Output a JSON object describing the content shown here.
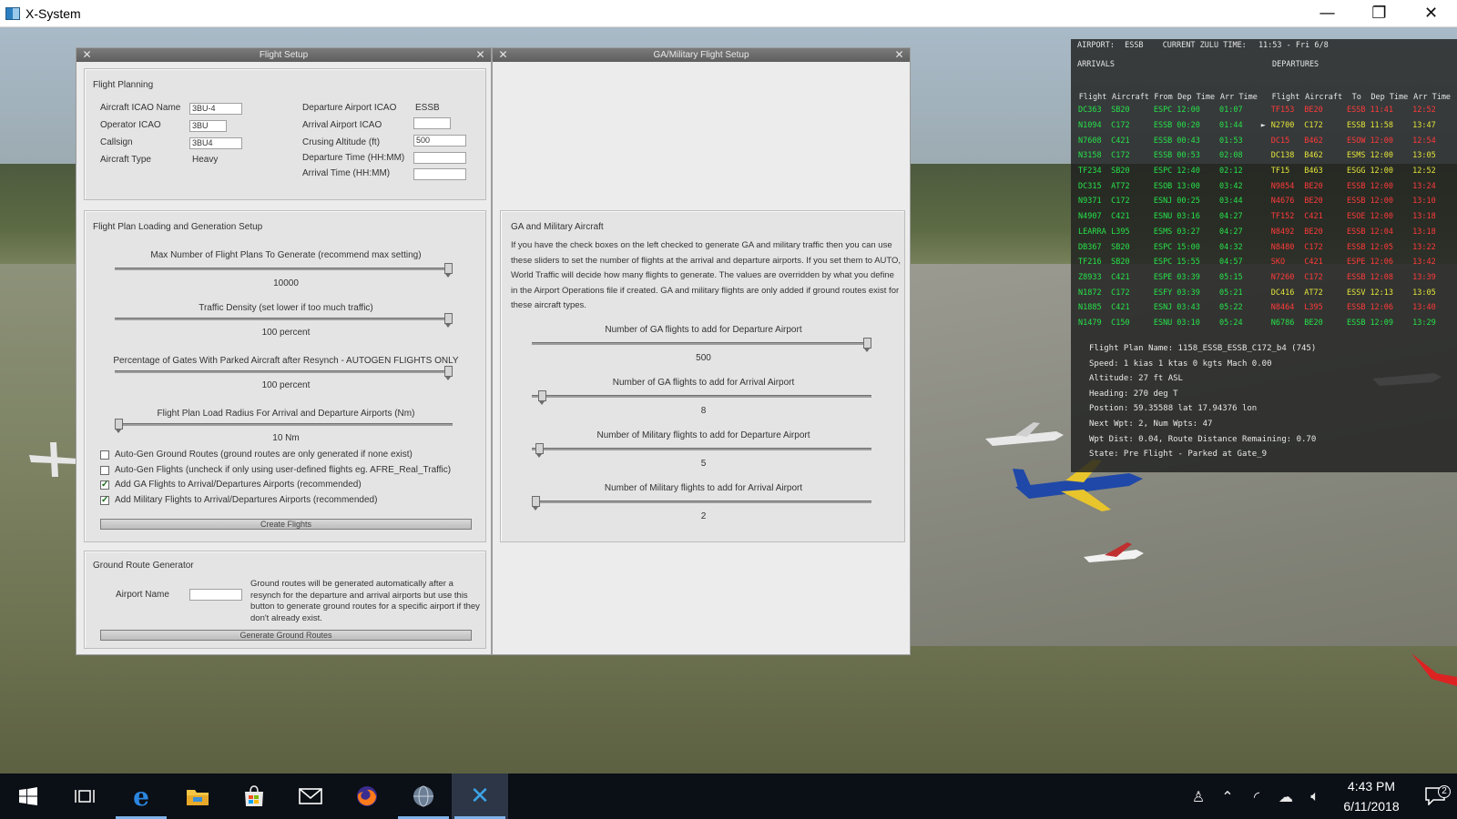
{
  "window": {
    "title": "X-System",
    "minimize": "—",
    "restore": "❐",
    "close": "✕"
  },
  "flight_setup": {
    "title": "Flight Setup",
    "planning": {
      "heading": "Flight Planning",
      "aircraft_icao_label": "Aircraft ICAO Name",
      "aircraft_icao_value": "3BU-4",
      "operator_icao_label": "Operator ICAO",
      "operator_icao_value": "3BU",
      "callsign_label": "Callsign",
      "callsign_value": "3BU4",
      "aircraft_type_label": "Aircraft Type",
      "aircraft_type_value": "Heavy",
      "departure_icao_label": "Departure Airport ICAO",
      "departure_icao_value": "ESSB",
      "arrival_icao_label": "Arrival Airport ICAO",
      "arrival_icao_value": "",
      "cruise_alt_label": "Crusing Altitude (ft)",
      "cruise_alt_value": "500",
      "departure_time_label": "Departure Time (HH:MM)",
      "departure_time_value": "",
      "arrival_time_label": "Arrival Time (HH:MM)",
      "arrival_time_value": ""
    },
    "loading": {
      "heading": "Flight Plan Loading and Generation Setup",
      "max_plans_label": "Max Number of Flight Plans To Generate (recommend max setting)",
      "max_plans_value": "10000",
      "max_plans_level": 1.0,
      "density_label": "Traffic Density (set lower if too much traffic)",
      "density_value": "100 percent",
      "density_level": 1.0,
      "gates_label": "Percentage of Gates With Parked Aircraft after Resynch - AUTOGEN FLIGHTS ONLY",
      "gates_value": "100 percent",
      "gates_level": 1.0,
      "radius_label": "Flight Plan Load Radius For Arrival and Departure Airports (Nm)",
      "radius_value": "10 Nm",
      "radius_level": 0.0,
      "checkboxes": [
        {
          "label": "Auto-Gen Ground Routes (ground routes are only generated if none exist)",
          "checked": false
        },
        {
          "label": "Auto-Gen Flights (uncheck if only using user-defined flights eg. AFRE_Real_Traffic)",
          "checked": false
        },
        {
          "label": "Add GA Flights to Arrival/Departures Airports (recommended)",
          "checked": true
        },
        {
          "label": "Add Military Flights to Arrival/Departures Airports (recommended)",
          "checked": true
        }
      ],
      "create_button": "Create Flights"
    },
    "ground": {
      "heading": "Ground Route Generator",
      "airport_label": "Airport Name",
      "airport_value": "",
      "description": "Ground routes will be generated automatically after a resynch for the departure and arrival airports but use this button to generate ground routes for a specific airport if they don't already exist.",
      "generate_button": "Generate Ground Routes"
    }
  },
  "ga_setup": {
    "title": "GA/Military Flight Setup",
    "heading": "GA and Military Aircraft",
    "description": "If you have the check boxes on the left checked to generate GA and military traffic then you can use these sliders to set the number of flights at the arrival and departure airports.  If you set them to AUTO, World Traffic will decide how many flights to generate. The values are overridden by what you define in the Airport Operations file if created. GA and military flights are only added if ground routes exist for these aircraft types.",
    "sliders": [
      {
        "label": "Number of GA flights to add for Departure Airport",
        "value": "500",
        "level": 1.0
      },
      {
        "label": "Number of GA flights to add for Arrival Airport",
        "value": "8",
        "level": 0.02
      },
      {
        "label": "Number of Military flights to add for Departure Airport",
        "value": "5",
        "level": 0.01
      },
      {
        "label": "Number of Military flights to add for Arrival Airport",
        "value": "2",
        "level": 0.0
      }
    ]
  },
  "atc": {
    "airport_label": "AIRPORT:",
    "airport": "ESSB",
    "zulu_label": "CURRENT ZULU TIME:",
    "zulu": "11:53 - Fri 6/8",
    "arrivals_title": "ARRIVALS",
    "departures_title": "DEPARTURES",
    "columns": [
      "Flight",
      "Aircraft",
      "From",
      "Dep Time",
      "Arr Time",
      "Flight",
      "Aircraft",
      "To",
      "Dep Time",
      "Arr Time"
    ],
    "rows": [
      {
        "arr": [
          "DC363",
          "SB20",
          "ESPC",
          "12:00",
          "01:07"
        ],
        "arr_color": "green",
        "dep": [
          "TF153",
          "BE20",
          "ESSB",
          "11:41",
          "12:52"
        ],
        "dep_color": "red",
        "marker": ""
      },
      {
        "arr": [
          "N1094",
          "C172",
          "ESSB",
          "00:20",
          "01:44"
        ],
        "arr_color": "green",
        "dep": [
          "N2700",
          "C172",
          "ESSB",
          "11:58",
          "13:47"
        ],
        "dep_color": "yellow",
        "marker": "►"
      },
      {
        "arr": [
          "N7608",
          "C421",
          "ESSB",
          "00:43",
          "01:53"
        ],
        "arr_color": "green",
        "dep": [
          "DC15",
          "B462",
          "ESOW",
          "12:00",
          "12:54"
        ],
        "dep_color": "red",
        "marker": ""
      },
      {
        "arr": [
          "N3158",
          "C172",
          "ESSB",
          "00:53",
          "02:08"
        ],
        "arr_color": "green",
        "dep": [
          "DC138",
          "B462",
          "ESMS",
          "12:00",
          "13:05"
        ],
        "dep_color": "yellow",
        "marker": ""
      },
      {
        "arr": [
          "TF234",
          "SB20",
          "ESPC",
          "12:40",
          "02:12"
        ],
        "arr_color": "green",
        "dep": [
          "TF15",
          "B463",
          "ESGG",
          "12:00",
          "12:52"
        ],
        "dep_color": "yellow",
        "marker": ""
      },
      {
        "arr": [
          "DC315",
          "AT72",
          "ESOB",
          "13:00",
          "03:42"
        ],
        "arr_color": "green",
        "dep": [
          "N9854",
          "BE20",
          "ESSB",
          "12:00",
          "13:24"
        ],
        "dep_color": "red",
        "marker": ""
      },
      {
        "arr": [
          "N9371",
          "C172",
          "ESNJ",
          "00:25",
          "03:44"
        ],
        "arr_color": "green",
        "dep": [
          "N4676",
          "BE20",
          "ESSB",
          "12:00",
          "13:10"
        ],
        "dep_color": "red",
        "marker": ""
      },
      {
        "arr": [
          "N4907",
          "C421",
          "ESNU",
          "03:16",
          "04:27"
        ],
        "arr_color": "green",
        "dep": [
          "TF152",
          "C421",
          "ESOE",
          "12:00",
          "13:18"
        ],
        "dep_color": "red",
        "marker": ""
      },
      {
        "arr": [
          "LEARRA",
          "L395",
          "ESMS",
          "03:27",
          "04:27"
        ],
        "arr_color": "green",
        "dep": [
          "N8492",
          "BE20",
          "ESSB",
          "12:04",
          "13:18"
        ],
        "dep_color": "red",
        "marker": ""
      },
      {
        "arr": [
          "DB367",
          "SB20",
          "ESPC",
          "15:00",
          "04:32"
        ],
        "arr_color": "green",
        "dep": [
          "N8480",
          "C172",
          "ESSB",
          "12:05",
          "13:22"
        ],
        "dep_color": "red",
        "marker": ""
      },
      {
        "arr": [
          "TF216",
          "SB20",
          "ESPC",
          "15:55",
          "04:57"
        ],
        "arr_color": "green",
        "dep": [
          "SKO",
          "C421",
          "ESPE",
          "12:06",
          "13:42"
        ],
        "dep_color": "red",
        "marker": ""
      },
      {
        "arr": [
          "Z8933",
          "C421",
          "ESPE",
          "03:39",
          "05:15"
        ],
        "arr_color": "green",
        "dep": [
          "N7260",
          "C172",
          "ESSB",
          "12:08",
          "13:39"
        ],
        "dep_color": "red",
        "marker": ""
      },
      {
        "arr": [
          "N1872",
          "C172",
          "ESFY",
          "03:39",
          "05:21"
        ],
        "arr_color": "green",
        "dep": [
          "DC416",
          "AT72",
          "ESSV",
          "12:13",
          "13:05"
        ],
        "dep_color": "yellow",
        "marker": ""
      },
      {
        "arr": [
          "N1885",
          "C421",
          "ESNJ",
          "03:43",
          "05:22"
        ],
        "arr_color": "green",
        "dep": [
          "N8464",
          "L395",
          "ESSB",
          "12:06",
          "13:40"
        ],
        "dep_color": "red",
        "marker": ""
      },
      {
        "arr": [
          "N1479",
          "C150",
          "ESNU",
          "03:10",
          "05:24"
        ],
        "arr_color": "green",
        "dep": [
          "N6786",
          "BE20",
          "ESSB",
          "12:09",
          "13:29"
        ],
        "dep_color": "green",
        "marker": ""
      }
    ],
    "info": [
      "Flight Plan Name:  1158_ESSB_ESSB_C172_b4  (745)",
      "Speed:  1 kias  1 ktas  0 kgts  Mach 0.00",
      "Altitude:  27 ft ASL",
      "Heading:  270 deg T",
      "Postion:  59.35588 lat 17.94376 lon",
      "Next Wpt: 2, Num Wpts: 47",
      "Wpt Dist: 0.04, Route Distance Remaining: 0.70",
      "State:  Pre Flight - Parked at Gate_9"
    ]
  },
  "taskbar": {
    "time": "4:43 PM",
    "date": "6/11/2018",
    "notification_count": "2"
  }
}
